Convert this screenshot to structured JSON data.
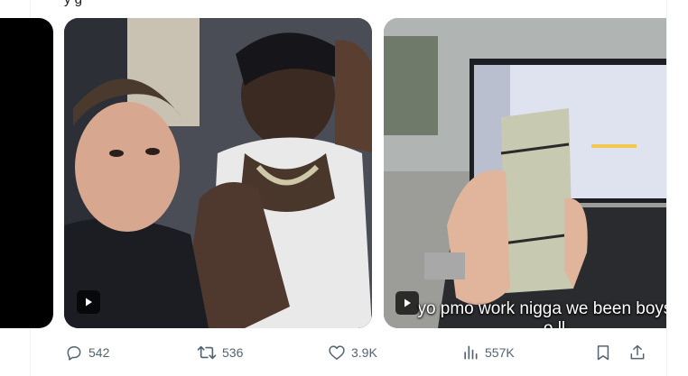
{
  "tweet": {
    "text_fragment": "y                                                          g"
  },
  "media": {
    "caption": "yo pmo work nigga we been boys fo",
    "caption_line2": "o ll"
  },
  "actions": {
    "replies": "542",
    "reposts": "536",
    "likes": "3.9K",
    "views": "557K"
  },
  "colors": {
    "action_gray": "#536471",
    "divider": "#eff3f4"
  }
}
